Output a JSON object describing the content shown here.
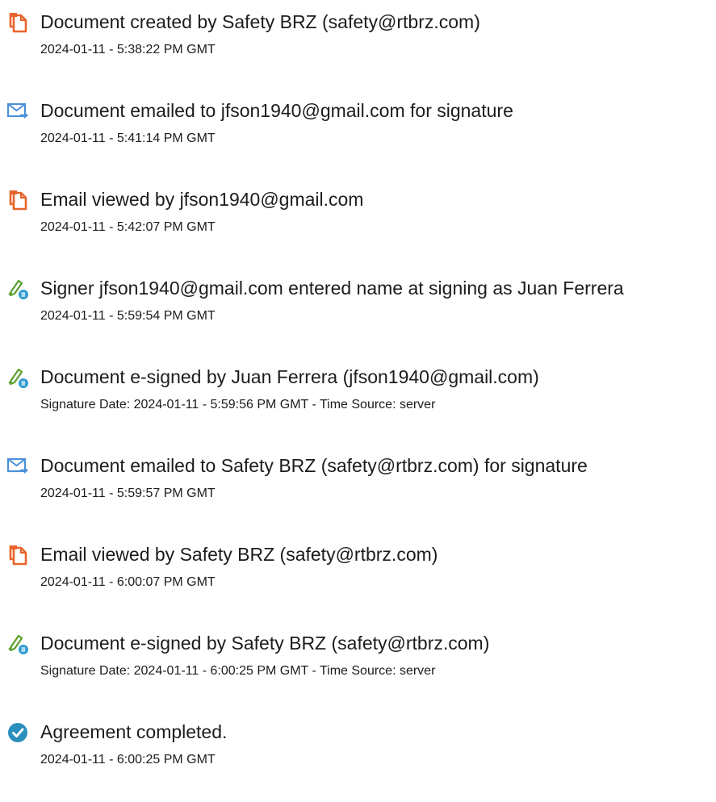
{
  "events": [
    {
      "icon": "document-created-icon",
      "title": "Document created by Safety BRZ (safety@rtbrz.com)",
      "date": "2024-01-11 - 5:38:22 PM GMT"
    },
    {
      "icon": "email-sent-icon",
      "title": "Document emailed to jfson1940@gmail.com for signature",
      "date": "2024-01-11 - 5:41:14 PM GMT"
    },
    {
      "icon": "document-viewed-icon",
      "title": "Email viewed by jfson1940@gmail.com",
      "date": "2024-01-11 - 5:42:07 PM GMT"
    },
    {
      "icon": "signature-pen-icon",
      "title": "Signer jfson1940@gmail.com entered name at signing as Juan Ferrera",
      "date": "2024-01-11 - 5:59:54 PM GMT"
    },
    {
      "icon": "signature-pen-icon",
      "title": "Document e-signed by Juan Ferrera (jfson1940@gmail.com)",
      "date": "Signature Date: 2024-01-11 - 5:59:56 PM GMT - Time Source: server"
    },
    {
      "icon": "email-sent-icon",
      "title": "Document emailed to Safety BRZ (safety@rtbrz.com) for signature",
      "date": "2024-01-11 - 5:59:57 PM GMT"
    },
    {
      "icon": "document-viewed-icon",
      "title": "Email viewed by Safety BRZ (safety@rtbrz.com)",
      "date": "2024-01-11 - 6:00:07 PM GMT"
    },
    {
      "icon": "signature-pen-icon",
      "title": "Document e-signed by Safety BRZ (safety@rtbrz.com)",
      "date": "Signature Date: 2024-01-11 - 6:00:25 PM GMT - Time Source: server"
    },
    {
      "icon": "check-circle-icon",
      "title": "Agreement completed.",
      "date": "2024-01-11 - 6:00:25 PM GMT"
    }
  ],
  "colors": {
    "document_icon": "#e8642c",
    "email_icon": "#4a90d9",
    "signature_icon": "#5aa02c",
    "check_icon": "#2a8fbd",
    "text": "#1c1c1c"
  }
}
